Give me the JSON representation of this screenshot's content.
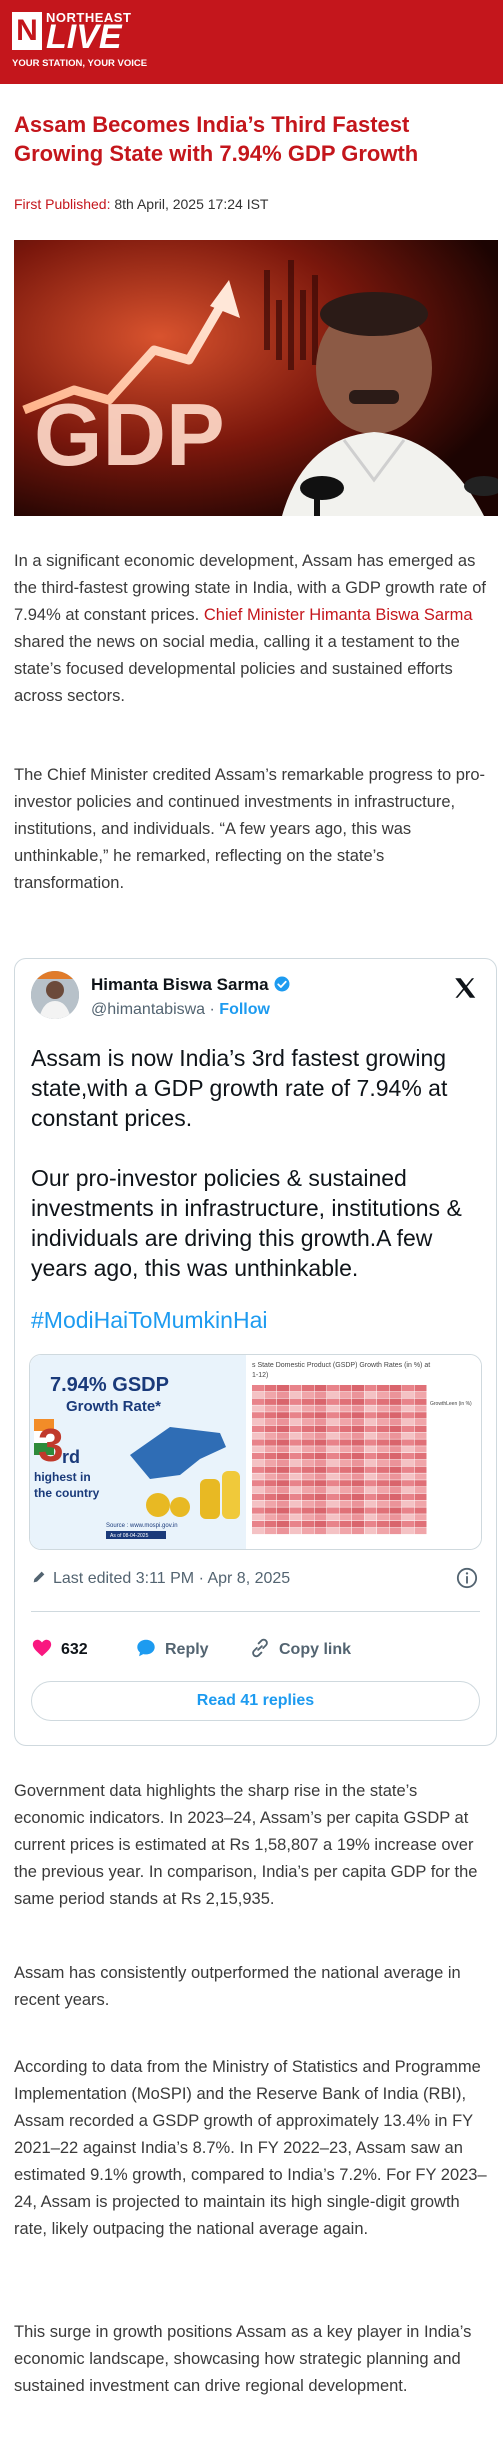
{
  "header": {
    "logo_box": "N",
    "logo_top": "NORTHEAST",
    "logo_main": "LIVE",
    "tagline": "YOUR STATION, YOUR VOICE"
  },
  "article": {
    "title": "Assam Becomes India’s Third Fastest Growing State with 7.94% GDP Growth",
    "published_label": "First Published:",
    "published_value": " 8th April, 2025 17:24 IST",
    "hero_image": {
      "gdp_text": "GDP",
      "colors": {
        "bg": "#2a0604",
        "accent": "#e8482b"
      }
    },
    "p1_a": "In a significant economic development, Assam has emerged as the third-fastest growing state in India, with a GDP growth rate of 7.94% at constant prices. ",
    "p1_link": "Chief Minister Himanta Biswa Sarma",
    "p1_b": " shared the news on social media, calling it a testament to the state’s focused developmental policies and sustained efforts across sectors.",
    "p2": "The Chief Minister credited Assam’s remarkable progress to pro-investor policies and continued investments in infrastructure, institutions, and individuals. “A few years ago, this was unthinkable,” he remarked, reflecting on the state’s transformation.",
    "p3": "Government data highlights the sharp rise in the state’s economic indicators. In 2023–24, Assam’s per capita GSDP at current prices is estimated at Rs 1,58,807 a 19% increase over the previous year. In comparison, India’s per capita GDP for the same period stands at Rs 2,15,935.",
    "p4": "Assam has consistently outperformed the national average in recent years.",
    "p5": "According to data from the Ministry of Statistics and Programme Implementation (MoSPI) and the Reserve Bank of India (RBI), Assam recorded a GSDP growth of approximately 13.4% in FY 2021–22 against India’s 8.7%. In FY 2022–23, Assam saw an estimated 9.1% growth, compared to India’s 7.2%. For FY 2023–24, Assam is projected to maintain its high single-digit growth rate, likely outpacing the national average again.",
    "p6": "This surge in growth positions Assam as a key player in India’s economic landscape, showcasing how strategic planning and sustained investment can drive regional development."
  },
  "tweet": {
    "name": "Himanta Biswa Sarma",
    "handle": "@himantabiswa",
    "separator": " · ",
    "follow": "Follow",
    "text": "Assam is now India’s 3rd fastest growing state,with a GDP growth rate of 7.94% at constant prices.\n\nOur pro-investor policies & sustained investments in infrastructure, institutions & individuals are driving this growth.A few years ago, this was unthinkable.",
    "hashtag": "#ModiHaiToMumkinHai",
    "media": {
      "headline": "7.94% GSDP",
      "subhead": "Growth Rate*",
      "rank_number": "3",
      "rank_suffix": "rd",
      "rank_line1": "highest in",
      "rank_line2": "the country",
      "source": "Source : www.mospi.gov.in",
      "asof": "As of 08-04-2025",
      "table_title": "s State Domestic Product (GSDP) Growth Rates (in %) at",
      "table_subtitle": "1-12)",
      "legend_title": "GrowthLeen (in %)"
    },
    "edited": "Last edited 3:11 PM · Apr 8, 2025",
    "likes": "632",
    "reply": "Reply",
    "copy_link": "Copy link",
    "read_replies": "Read 41 replies",
    "colors": {
      "link": "#1d9bf0",
      "heart": "#f91880"
    }
  },
  "colors": {
    "brand": "#c4161c"
  }
}
